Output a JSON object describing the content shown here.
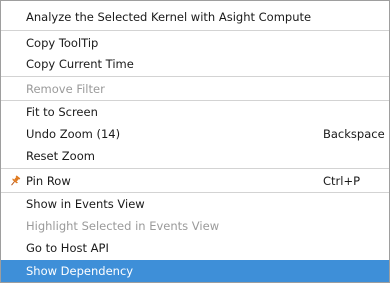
{
  "context_menu": {
    "items": [
      {
        "label": "Analyze the Selected Kernel with Asight Compute",
        "state": "normal"
      },
      {
        "label": "Copy ToolTip",
        "state": "normal"
      },
      {
        "label": "Copy Current Time",
        "state": "normal"
      },
      {
        "label": "Remove Filter",
        "state": "disabled"
      },
      {
        "label": "Fit to Screen",
        "state": "normal"
      },
      {
        "label": "Undo Zoom (14)",
        "shortcut": "Backspace",
        "state": "normal"
      },
      {
        "label": "Reset Zoom",
        "state": "normal"
      },
      {
        "label": "Pin Row",
        "shortcut": "Ctrl+P",
        "icon": "pin-icon",
        "state": "normal"
      },
      {
        "label": "Show in Events View",
        "state": "normal"
      },
      {
        "label": "Highlight Selected in Events View",
        "state": "disabled"
      },
      {
        "label": "Go to Host API",
        "state": "normal"
      },
      {
        "label": "Show Dependency",
        "state": "highlighted"
      }
    ]
  },
  "colors": {
    "highlight": "#3e8fd8",
    "pin_icon": "#e07a20",
    "disabled_text": "#9a9a9a"
  }
}
